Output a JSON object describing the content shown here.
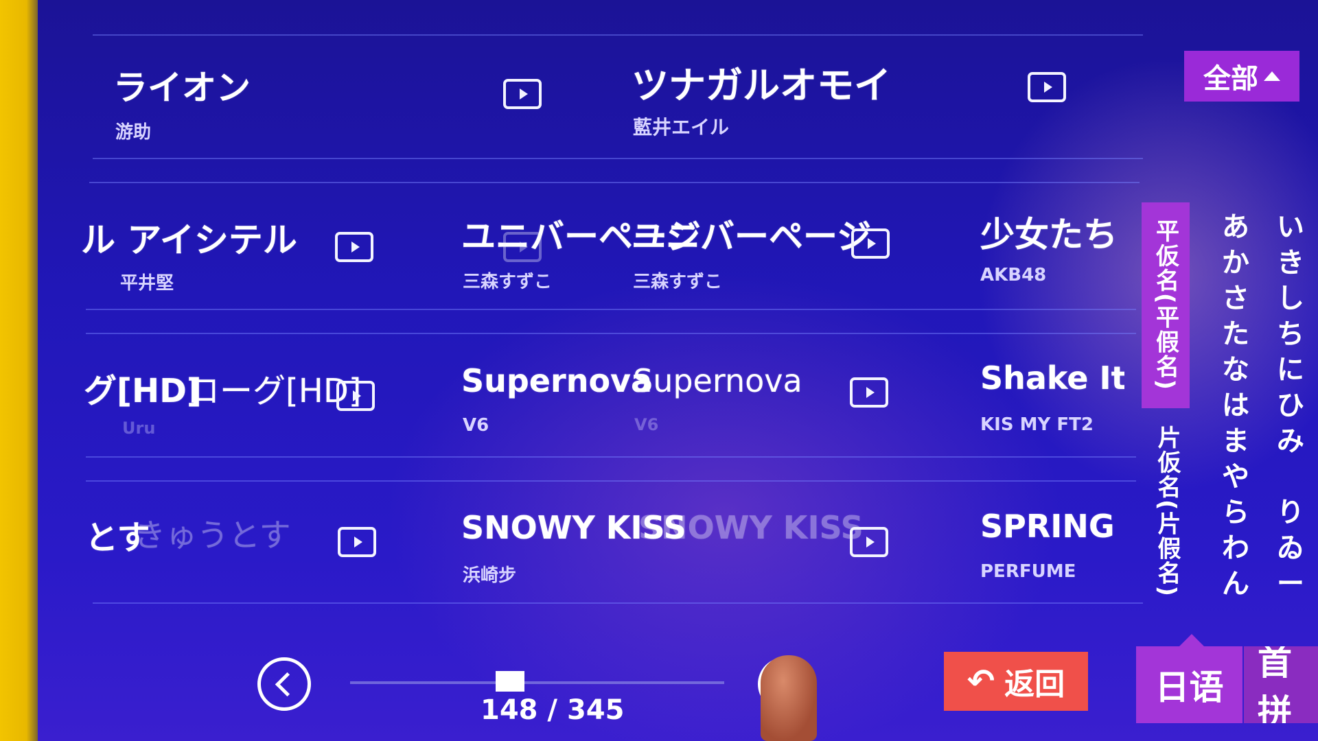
{
  "filter": {
    "label": "全部"
  },
  "rows": [
    [
      {
        "title": "ライオン",
        "artist": "游助"
      },
      {
        "title": "ツナガルオモイ",
        "artist": "藍井エイル"
      }
    ],
    [
      {
        "title": "ル アイシテル",
        "artist": "平井堅"
      },
      {
        "title": "ユニバーページ",
        "artist": "三森すずこ"
      },
      {
        "title": "ユニバーページ",
        "artist": "三森すずこ"
      },
      {
        "title": "少女たち",
        "artist": "AKB48"
      }
    ],
    [
      {
        "title": "グ[HD]",
        "artist": "Uru"
      },
      {
        "title": "ローグ[HD]",
        "artist": ""
      },
      {
        "title": "Supernova",
        "artist": "V6"
      },
      {
        "title": "Supernova",
        "artist": "V6"
      },
      {
        "title": "Shake It U",
        "artist": "KIS MY FT2"
      }
    ],
    [
      {
        "title": "とす",
        "artist": ""
      },
      {
        "title": "きゅうとす",
        "artist": ""
      },
      {
        "title": "SNOWY KISS",
        "artist": "浜崎步"
      },
      {
        "title": "SNOWY KISS",
        "artist": ""
      },
      {
        "title": "SPRING C",
        "artist": "PERFUME"
      }
    ]
  ],
  "index_tabs": {
    "hiragana": "平仮名(平假名)",
    "katakana": "片仮名(片假名)"
  },
  "kana_col1": [
    "あ",
    "か",
    "さ",
    "た",
    "な",
    "は",
    "ま",
    "や",
    "ら",
    "わ",
    "ん"
  ],
  "kana_col2": [
    "い",
    "き",
    "し",
    "ち",
    "に",
    "ひ",
    "み",
    "",
    "り",
    "ゐ",
    "ー"
  ],
  "pager": {
    "text": "148 / 345",
    "current": 148,
    "total": 345
  },
  "back_button": {
    "label": "返回"
  },
  "lang_tabs": {
    "active": "日语",
    "other": "首拼"
  },
  "colors": {
    "accent": "#a335d8",
    "back": "#f0504a",
    "background": "#2117b8"
  }
}
